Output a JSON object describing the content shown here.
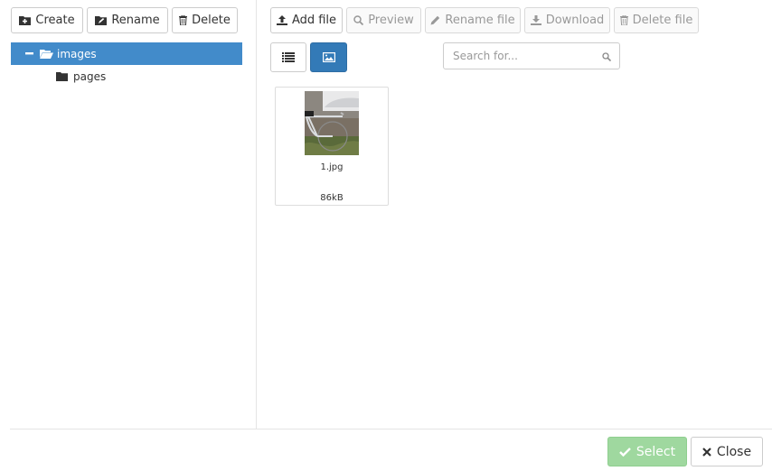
{
  "left_toolbar": {
    "create_label": "Create",
    "rename_label": "Rename",
    "delete_label": "Delete"
  },
  "tree": {
    "root_label": "images",
    "child_label": "pages"
  },
  "right_toolbar": {
    "add_file_label": "Add file",
    "preview_label": "Preview",
    "rename_file_label": "Rename file",
    "download_label": "Download",
    "delete_file_label": "Delete file"
  },
  "search": {
    "placeholder": "Search for..."
  },
  "files": [
    {
      "name": "1.jpg",
      "size": "86kB"
    }
  ],
  "footer": {
    "select_label": "Select",
    "close_label": "Close"
  },
  "colors": {
    "accent": "#428bca",
    "success": "#9fd89f"
  }
}
